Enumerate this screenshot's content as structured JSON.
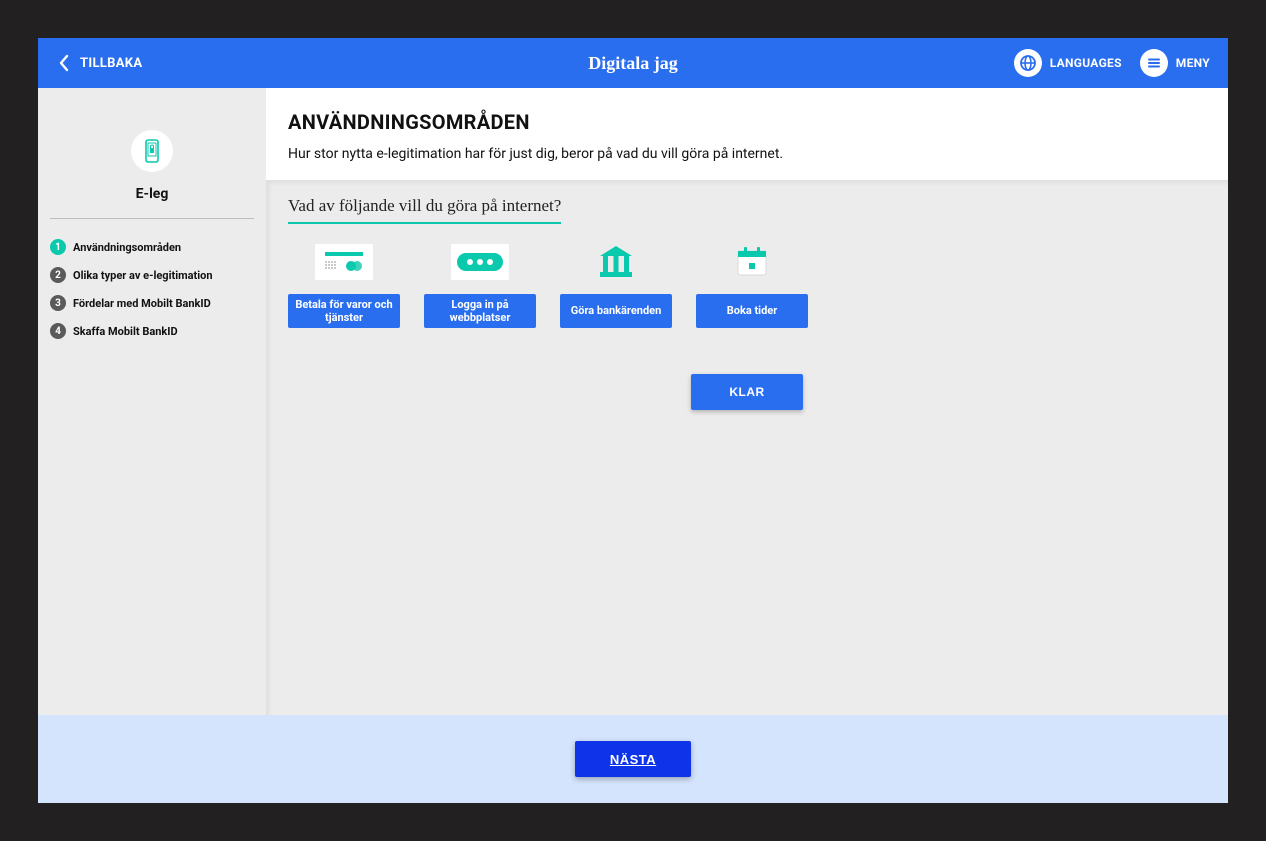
{
  "header": {
    "back_label": "TILLBAKA",
    "title": "Digitala jag",
    "languages_label": "LANGUAGES",
    "menu_label": "MENY"
  },
  "sidebar": {
    "title": "E-leg",
    "steps": [
      {
        "num": "1",
        "label": "Användningsområden",
        "active": true
      },
      {
        "num": "2",
        "label": "Olika typer av e-legitimation",
        "active": false
      },
      {
        "num": "3",
        "label": "Fördelar med Mobilt BankID",
        "active": false
      },
      {
        "num": "4",
        "label": "Skaffa Mobilt BankID",
        "active": false
      }
    ]
  },
  "main": {
    "intro_heading": "ANVÄNDNINGSOMRÅDEN",
    "intro_text": "Hur stor nytta e-legitimation har för just dig, beror på vad du vill göra på internet.",
    "question": "Vad av följande vill du göra på internet?",
    "options": [
      {
        "label": "Betala för varor och tjänster",
        "icon": "credit-card-icon"
      },
      {
        "label": "Logga in på webbplatser",
        "icon": "password-icon"
      },
      {
        "label": "Göra bankärenden",
        "icon": "bank-icon"
      },
      {
        "label": "Boka tider",
        "icon": "calendar-icon"
      }
    ],
    "klar_label": "KLAR"
  },
  "footer": {
    "next_label": "NÄSTA"
  },
  "colors": {
    "primary": "#2a6ef0",
    "teal": "#0bc9ad",
    "deep_blue": "#0f33e8"
  }
}
